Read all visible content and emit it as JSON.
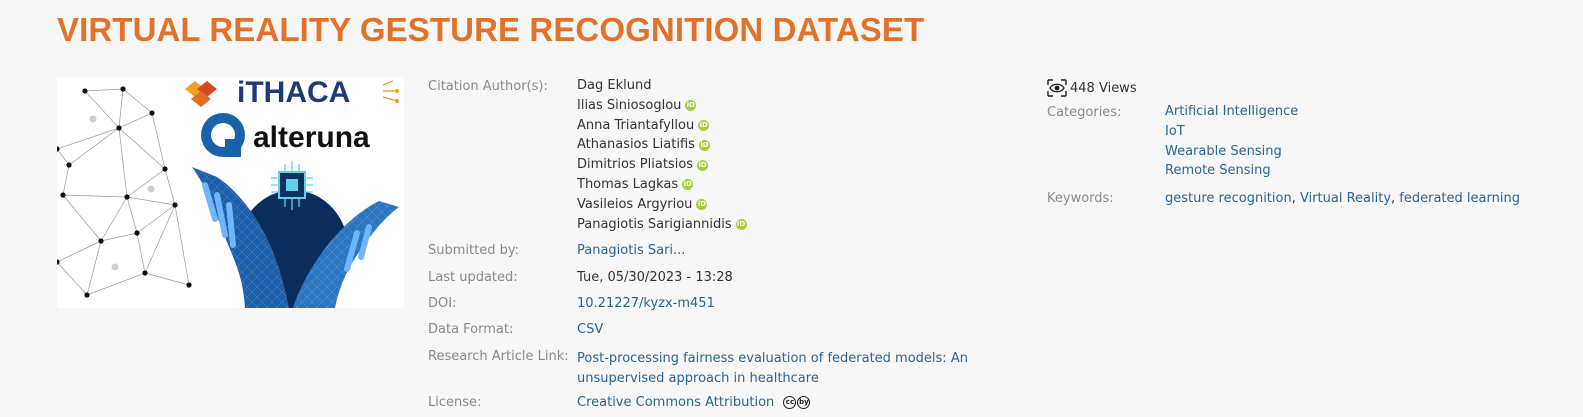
{
  "dataset": {
    "title": "VIRTUAL REALITY GESTURE RECOGNITION DATASET"
  },
  "thumbnail": {
    "logo_top": "iTHACA",
    "logo_mid": "alteruna"
  },
  "meta": {
    "labels": {
      "authors": "Citation Author(s):",
      "submitted_by": "Submitted by:",
      "last_updated": "Last updated:",
      "doi": "DOI:",
      "data_format": "Data Format:",
      "research_article": "Research Article Link:",
      "license": "License:"
    },
    "authors": [
      {
        "name": "Dag Eklund",
        "orcid": false
      },
      {
        "name": "Ilias Siniosoglou",
        "orcid": true
      },
      {
        "name": "Anna Triantafyllou",
        "orcid": true
      },
      {
        "name": "Athanasios Liatifis",
        "orcid": true
      },
      {
        "name": "Dimitrios Pliatsios",
        "orcid": true
      },
      {
        "name": "Thomas Lagkas",
        "orcid": true
      },
      {
        "name": "Vasileios Argyriou",
        "orcid": true
      },
      {
        "name": "Panagiotis Sarigiannidis",
        "orcid": true
      }
    ],
    "orcid_glyph": "iD",
    "submitted_by": "Panagiotis Sari...",
    "last_updated": "Tue, 05/30/2023 - 13:28",
    "doi": "10.21227/kyzx-m451",
    "data_format": "CSV",
    "research_article_line1": "Post-processing fairness evaluation of federated models: An",
    "research_article_line2": "unsupervised approach in healthcare",
    "license": "Creative Commons Attribution",
    "license_icons": [
      "cc",
      "by"
    ]
  },
  "sidebar": {
    "views_count": "448",
    "views_label": "Views",
    "labels": {
      "categories": "Categories:",
      "keywords": "Keywords:"
    },
    "categories": [
      "Artificial Intelligence",
      "IoT",
      "Wearable Sensing",
      "Remote Sensing"
    ],
    "keywords": [
      "gesture recognition",
      "Virtual Reality",
      "federated learning"
    ],
    "keyword_separator": ", "
  },
  "colors": {
    "title": "#e2722a",
    "link": "#2a6496",
    "label": "#8a8a8a",
    "orcid": "#a6ce39",
    "background": "#f7f7f7"
  },
  "icons": {
    "views": "eye-icon",
    "orcid": "orcid-icon",
    "license": "creative-commons-icon"
  }
}
